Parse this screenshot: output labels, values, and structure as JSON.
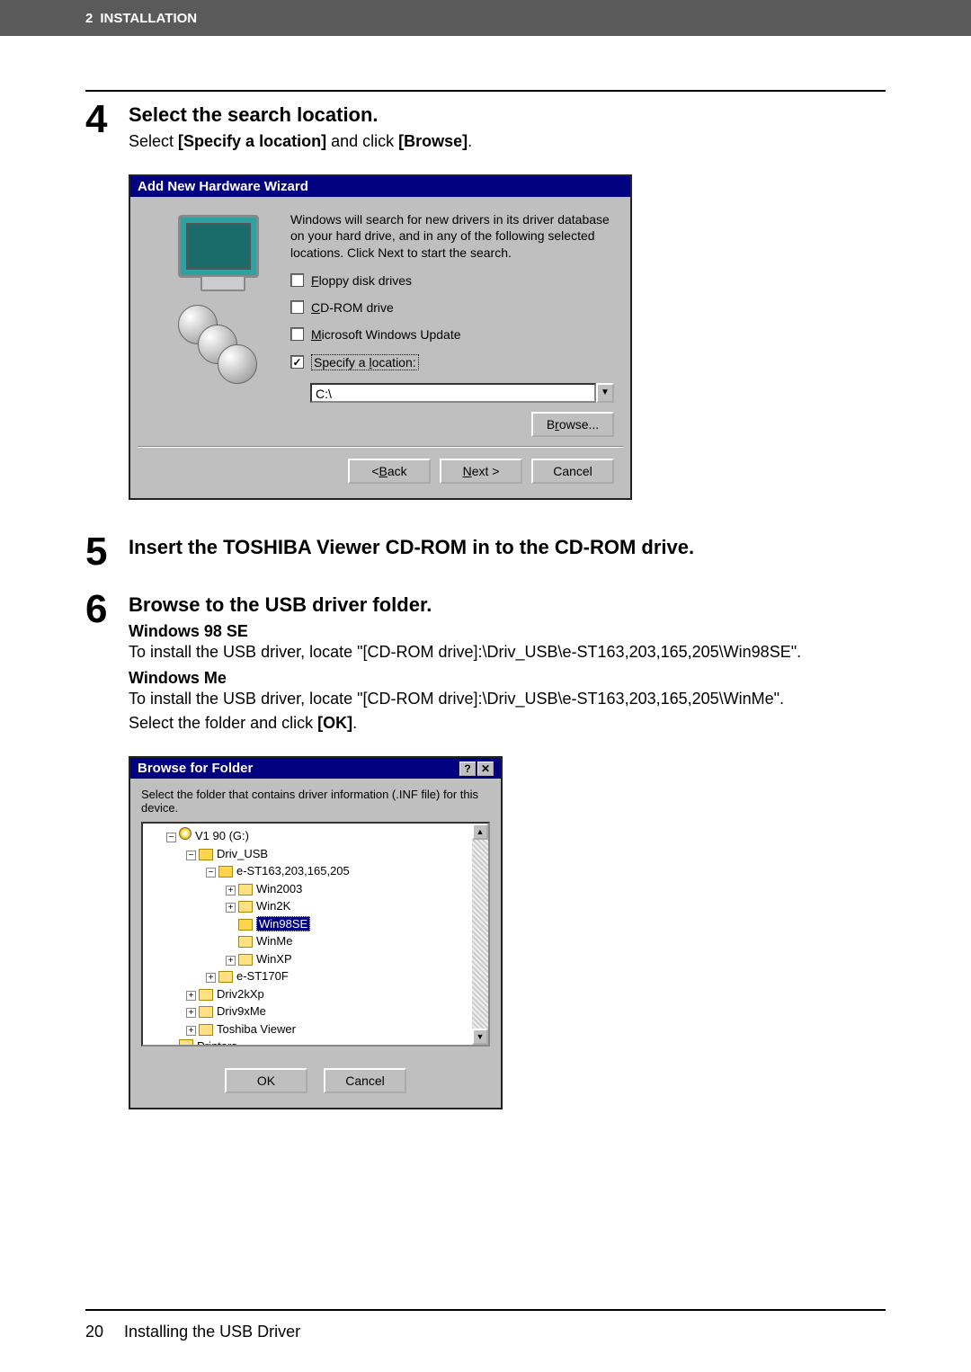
{
  "header": {
    "chapnum": "2",
    "chapter": "INSTALLATION"
  },
  "step4": {
    "num": "4",
    "title": "Select the search location.",
    "instr_pre": "Select ",
    "instr_b1": "[Specify a location]",
    "instr_mid": " and click ",
    "instr_b2": "[Browse]",
    "instr_end": "."
  },
  "wiz": {
    "title": "Add New Hardware Wizard",
    "para": "Windows will search for new drivers in its driver database on your hard drive, and in any of the following selected locations. Click Next to start the search.",
    "floppy_u": "F",
    "floppy": "loppy disk drives",
    "cd_u": "C",
    "cd": "D-ROM drive",
    "ms_u": "M",
    "ms": "icrosoft Windows Update",
    "spec_pre": "Specify a ",
    "spec_u": "l",
    "spec_post": "ocation:",
    "loc_value": "C:\\",
    "browse_pre": "B",
    "browse_u": "r",
    "browse_post": "owse...",
    "back_lt": "< ",
    "back_u": "B",
    "back_post": "ack",
    "next_pre": "",
    "next_u": "N",
    "next_post": "ext >",
    "cancel": "Cancel"
  },
  "step5": {
    "num": "5",
    "title": "Insert the TOSHIBA Viewer CD-ROM in to the CD-ROM drive."
  },
  "step6": {
    "num": "6",
    "title": "Browse to the USB driver folder.",
    "w98h": "Windows 98 SE",
    "w98t": "To install the USB driver, locate \"[CD-ROM drive]:\\Driv_USB\\e-ST163,203,165,205\\Win98SE\".",
    "wmeh": "Windows Me",
    "wmet": "To install the USB driver, locate \"[CD-ROM drive]:\\Driv_USB\\e-ST163,203,165,205\\WinMe\".",
    "last_pre": "Select the folder and click ",
    "last_b": "[OK]",
    "last_end": "."
  },
  "bff": {
    "title": "Browse for Folder",
    "help": "?",
    "close": "✕",
    "msg": "Select the folder that contains driver information (.INF file) for this device.",
    "root": "V1      90 (G:)",
    "n_driv_usb": "Driv_USB",
    "n_est": "e-ST163,203,165,205",
    "n_win2003": "Win2003",
    "n_win2k": "Win2K",
    "n_win98se": "Win98SE",
    "n_winme": "WinMe",
    "n_winxp": "WinXP",
    "n_est170f": "e-ST170F",
    "n_driv2kxp": "Driv2kXp",
    "n_driv9xme": "Driv9xMe",
    "n_tv": "Toshiba Viewer",
    "n_printers": "Printers",
    "ok": "OK",
    "cancel": "Cancel",
    "up": "▲",
    "down": "▼",
    "plus": "+",
    "minus": "−"
  },
  "footer": {
    "page": "20",
    "text": "Installing the USB Driver"
  }
}
